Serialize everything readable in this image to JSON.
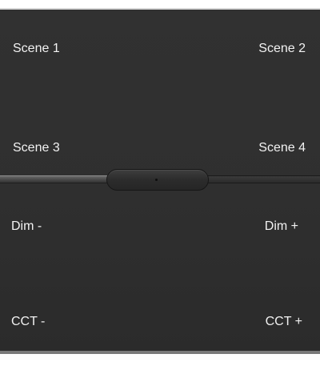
{
  "buttons": {
    "scene_1": "Scene 1",
    "scene_2": "Scene 2",
    "scene_3": "Scene 3",
    "scene_4": "Scene 4",
    "dim_minus": "Dim -",
    "dim_plus": "Dim +",
    "cct_minus": "CCT -",
    "cct_plus": "CCT +"
  },
  "slider": {
    "level": 0.4
  },
  "colors": {
    "panel": "#2f2f2f",
    "text": "#f2f2f2",
    "rail_left": "#4e4e4e",
    "rail_right": "#2c2c2c"
  }
}
